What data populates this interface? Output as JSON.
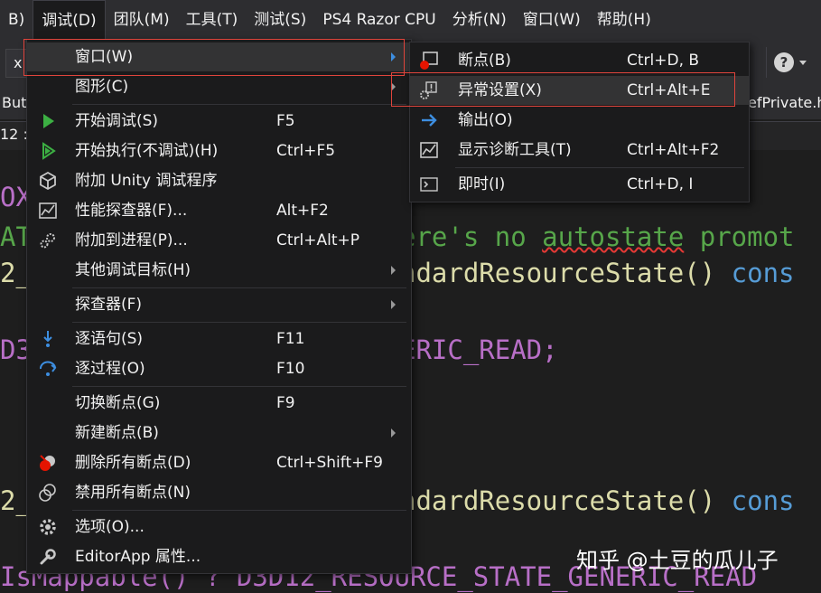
{
  "menubar": {
    "items": [
      {
        "label": "B)"
      },
      {
        "label": "调试(D)"
      },
      {
        "label": "团队(M)"
      },
      {
        "label": "工具(T)"
      },
      {
        "label": "测试(S)"
      },
      {
        "label": "PS4 Razor CPU"
      },
      {
        "label": "分析(N)"
      },
      {
        "label": "窗口(W)"
      },
      {
        "label": "帮助(H)"
      }
    ]
  },
  "toolbar": {
    "combo_text": "x"
  },
  "tabs": {
    "left_fragment": "But",
    "right_fragment": "efPrivate.h",
    "nav_fragment": "12 :"
  },
  "code": {
    "line1": "OX",
    "line2a": "AT",
    "line2b": "ere's no ",
    "line2c": "autostate",
    "line2d": " promot",
    "line3a": "2_",
    "line3b": "ndardResourceState() ",
    "line3c": "cons",
    "line4a": "D3",
    "line4b": "ERIC_READ;",
    "line5a": "2_",
    "line5b": "ndardResourceState() ",
    "line5c": "cons",
    "line6": "IsMappable() ? D3D12_RESOURCE_STATE_GENERIC_READ"
  },
  "debug_menu": {
    "items": [
      {
        "label": "窗口(W)",
        "shortcut": ""
      },
      {
        "label": "图形(C)",
        "shortcut": ""
      },
      {
        "label": "开始调试(S)",
        "shortcut": "F5"
      },
      {
        "label": "开始执行(不调试)(H)",
        "shortcut": "Ctrl+F5"
      },
      {
        "label": "附加 Unity 调试程序",
        "shortcut": ""
      },
      {
        "label": "性能探查器(F)...",
        "shortcut": "Alt+F2"
      },
      {
        "label": "附加到进程(P)...",
        "shortcut": "Ctrl+Alt+P"
      },
      {
        "label": "其他调试目标(H)",
        "shortcut": ""
      },
      {
        "label": "探查器(F)",
        "shortcut": ""
      },
      {
        "label": "逐语句(S)",
        "shortcut": "F11"
      },
      {
        "label": "逐过程(O)",
        "shortcut": "F10"
      },
      {
        "label": "切换断点(G)",
        "shortcut": "F9"
      },
      {
        "label": "新建断点(B)",
        "shortcut": ""
      },
      {
        "label": "删除所有断点(D)",
        "shortcut": "Ctrl+Shift+F9"
      },
      {
        "label": "禁用所有断点(N)",
        "shortcut": ""
      },
      {
        "label": "选项(O)...",
        "shortcut": ""
      },
      {
        "label": "EditorApp 属性...",
        "shortcut": ""
      }
    ]
  },
  "window_submenu": {
    "items": [
      {
        "label": "断点(B)",
        "shortcut": "Ctrl+D, B"
      },
      {
        "label": "异常设置(X)",
        "shortcut": "Ctrl+Alt+E"
      },
      {
        "label": "输出(O)",
        "shortcut": ""
      },
      {
        "label": "显示诊断工具(T)",
        "shortcut": "Ctrl+Alt+F2"
      },
      {
        "label": "即时(I)",
        "shortcut": "Ctrl+D, I"
      }
    ]
  },
  "watermark": "知乎 @土豆的瓜儿子",
  "colors": {
    "highlight_box": "#e0443c",
    "play_green": "#3cb043",
    "breakpoint_red": "#e51400",
    "keyword_blue": "#569cd6",
    "function_yellow": "#dcdcaa",
    "comment_green": "#57a64a",
    "macro_purple": "#b86fc7"
  }
}
